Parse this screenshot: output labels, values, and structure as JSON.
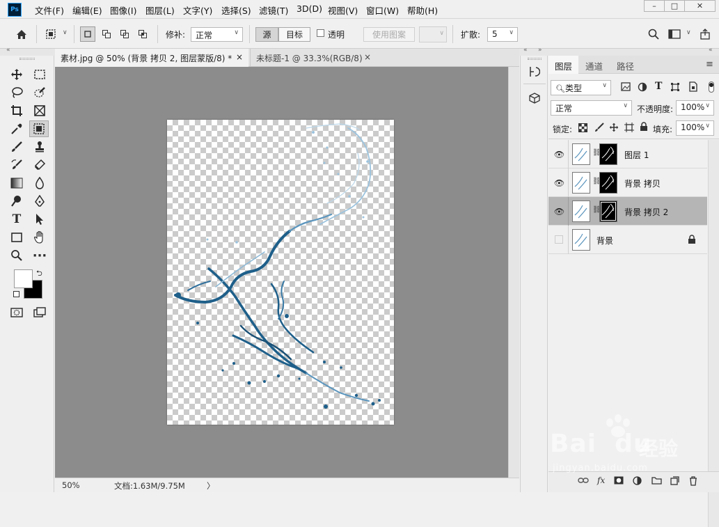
{
  "app": {
    "logo": "Ps"
  },
  "menu": [
    "文件(F)",
    "编辑(E)",
    "图像(I)",
    "图层(L)",
    "文字(Y)",
    "选择(S)",
    "滤镜(T)",
    "3D(D)",
    "视图(V)",
    "窗口(W)",
    "帮助(H)"
  ],
  "window_controls": {
    "minimize": "–",
    "maximize": "□",
    "close": "✕"
  },
  "options": {
    "patch_label": "修补:",
    "patch_mode": "正常",
    "source": "源",
    "target": "目标",
    "transparent": "透明",
    "use_pattern": "使用图案",
    "diffuse_label": "扩散:",
    "diffuse_value": "5"
  },
  "doc_tabs": [
    {
      "title": "素材.jpg @ 50% (背景 拷贝 2, 图层蒙版/8) *",
      "close": "×",
      "active": true
    },
    {
      "title": "未标题-1 @ 33.3%(RGB/8)",
      "close": "×",
      "active": false
    }
  ],
  "status": {
    "zoom": "50%",
    "doc": "文档:1.63M/9.75M",
    "arrow": "〉"
  },
  "panel": {
    "tabs": [
      "图层",
      "通道",
      "路径"
    ],
    "filter_kind": "类型",
    "blend_mode": "正常",
    "opacity_label": "不透明度:",
    "opacity_value": "100%",
    "lock_label": "锁定:",
    "fill_label": "填充:",
    "fill_value": "100%"
  },
  "layers": [
    {
      "name": "图层 1",
      "visible": true,
      "mask": true,
      "selected": false,
      "locked": false
    },
    {
      "name": "背景 拷贝",
      "visible": true,
      "mask": true,
      "selected": false,
      "locked": false
    },
    {
      "name": "背景 拷贝 2",
      "visible": true,
      "mask": true,
      "selected": true,
      "locked": false
    },
    {
      "name": "背景",
      "visible": false,
      "mask": false,
      "selected": false,
      "locked": true
    }
  ],
  "panel_bottom": {
    "fx": "fx"
  },
  "watermark": {
    "brand": "Bai",
    "brand2": "du",
    "cn": "经验",
    "url": "jingyan.baidu.com"
  },
  "colors": {
    "accent_ps": "#31a8ff",
    "workspace": "#8c8c8c",
    "water": "#1e5f8a"
  }
}
